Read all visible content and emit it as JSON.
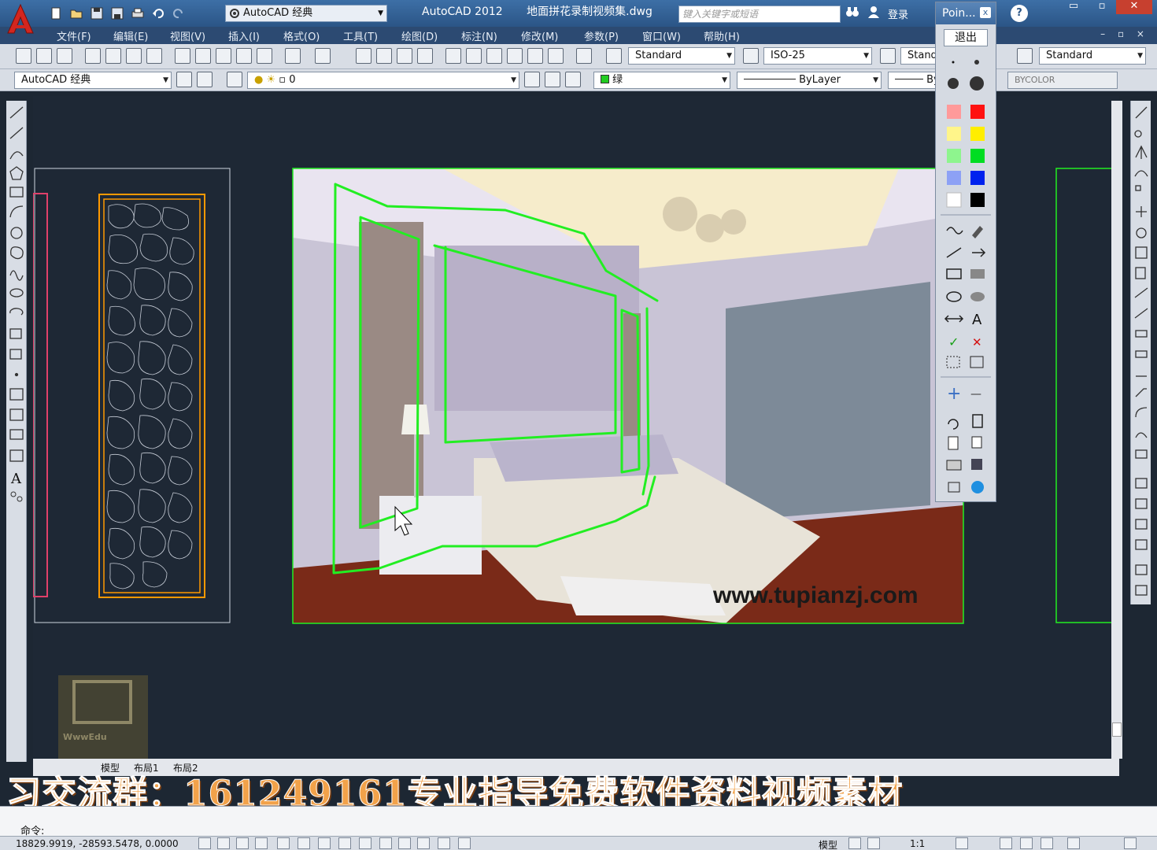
{
  "app": {
    "product": "AutoCAD 2012",
    "document": "地面拼花录制视频集.dwg",
    "workspace": "AutoCAD 经典",
    "search_placeholder": "键入关键字或短语",
    "login": "登录",
    "help": "?"
  },
  "window_controls": {
    "minimize": "▭",
    "restore": "▫",
    "close": "✕"
  },
  "menu": [
    "文件(F)",
    "编辑(E)",
    "视图(V)",
    "插入(I)",
    "格式(O)",
    "工具(T)",
    "绘图(D)",
    "标注(N)",
    "修改(M)",
    "参数(P)",
    "窗口(W)",
    "帮助(H)"
  ],
  "mdi_controls": "– ▫ ×",
  "toolbar1": {
    "text_style": "Standard",
    "dim_style": "ISO-25",
    "table_style": "Stand",
    "multileader_style": "Standard"
  },
  "toolbar2": {
    "workspace": "AutoCAD 经典",
    "layer": "0",
    "color": "绿",
    "linetype": "ByLayer",
    "lineweight": "By",
    "plot_style": "BYCOLOR"
  },
  "markup_palette": {
    "title": "Poin...",
    "close": "x",
    "exit": "退出",
    "colors": [
      "#ff3333",
      "#ffee00",
      "#00dd22",
      "#0022ee",
      "#ffffff",
      "#000000"
    ],
    "text_tool": "A",
    "check": "✓",
    "cross": "✕",
    "plus": "+",
    "minus": "—"
  },
  "drawing": {
    "watermark": "www.tupianzj.com",
    "outline_color": "#22ee22",
    "panel_border_color": "#ff9900",
    "stamp_text": "WwwEdu"
  },
  "layout_tabs": [
    "模型",
    "布局1",
    "布局2"
  ],
  "banner_text": "习交流群：161249161专业指导免费软件资料视频素材",
  "command_prompt": "命令:",
  "status": {
    "coordinates": "18829.9919,  -28593.5478,  0.0000",
    "model_label": "模型",
    "scale": "1:1"
  }
}
